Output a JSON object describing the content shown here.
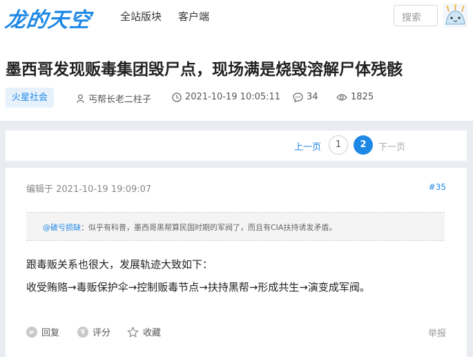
{
  "header": {
    "logo": "龙的天空",
    "nav": [
      "全站版块",
      "客户端"
    ],
    "search_label": "搜索"
  },
  "thread": {
    "title": "墨西哥发现贩毒集团毁尸点，现场满是烧毁溶解尸体残骸",
    "tag": "火星社会",
    "author": "丐帮长老二柱子",
    "datetime": "2021-10-19 10:05:11",
    "comments": "34",
    "views": "1825"
  },
  "pager": {
    "prev": "上一页",
    "pages": [
      "1",
      "2"
    ],
    "current": "2",
    "next": "下一页"
  },
  "post": {
    "edit_time": "编辑于 2021-10-19 19:09:07",
    "floor": "#35",
    "quote_name": "@破亏损缺",
    "quote_text": "：似乎有科普，墨西哥黑帮算民国时期的军阀了，而且有CIA扶持诱发矛盾。",
    "body_line1": "跟毒贩关系也很大，发展轨迹大致如下：",
    "body_line2": "收受贿赂→毒贩保护伞→控制贩毒节点→扶持黑帮→形成共生→演变成军阀。",
    "actions": {
      "reply": "回复",
      "rate": "评分",
      "favorite": "收藏"
    },
    "report": "举报"
  },
  "colors": {
    "accent": "#1e88e5",
    "tag_bg": "#e6f1fc",
    "page_bg": "#e9ecf1"
  },
  "icons": [
    "user-icon",
    "clock-icon",
    "comment-icon",
    "eye-icon",
    "reply-icon",
    "rate-icon",
    "star-icon",
    "avatar-icon"
  ]
}
